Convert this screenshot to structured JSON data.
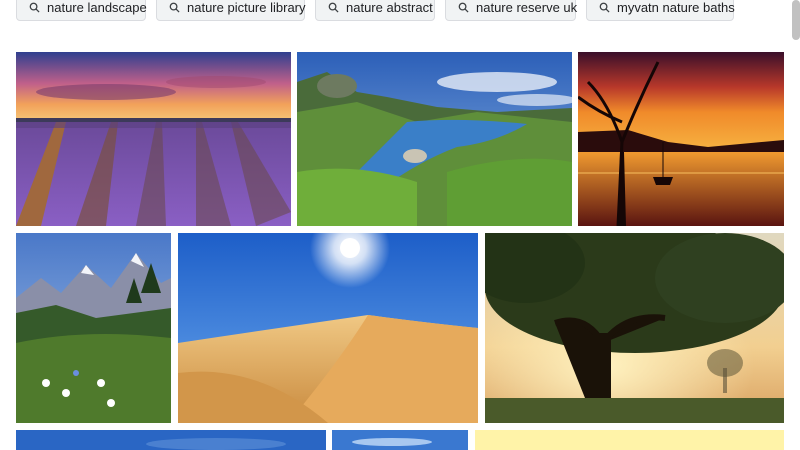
{
  "chips": [
    {
      "label": "nature landscape",
      "icon": "search-icon"
    },
    {
      "label": "nature picture library",
      "icon": "search-icon"
    },
    {
      "label": "nature abstract",
      "icon": "search-icon"
    },
    {
      "label": "nature reserve uk",
      "icon": "search-icon"
    },
    {
      "label": "myvatn nature baths",
      "icon": "search-icon"
    }
  ],
  "images": [
    {
      "subject": "lavender-field-sunset"
    },
    {
      "subject": "mountain-stream-meadow"
    },
    {
      "subject": "lake-sunset-silhouette-tree"
    },
    {
      "subject": "mountain-wildflower-meadow"
    },
    {
      "subject": "desert-dune-sun"
    },
    {
      "subject": "misty-tree-sunrise"
    },
    {
      "subject": "blue-sky-landscape"
    },
    {
      "subject": "blue-sky-landscape"
    },
    {
      "subject": "pale-yellow-placeholder"
    }
  ],
  "colors": {
    "chip_bg": "#f1f3f4",
    "chip_border": "#dadce0",
    "text": "#202124"
  }
}
